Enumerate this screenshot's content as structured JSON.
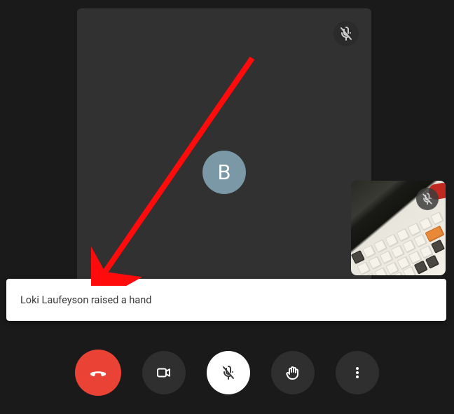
{
  "participant": {
    "avatar_initial": "B"
  },
  "notification": {
    "text": "Loki Laufeyson raised a hand"
  },
  "icons": {
    "participant_muted": "mic-muted-icon",
    "self_muted": "mic-muted-icon",
    "hangup": "phone-hangup-icon",
    "camera": "camera-icon",
    "mic_muted": "mic-muted-icon",
    "raise_hand": "hand-icon",
    "more": "more-icon"
  },
  "colors": {
    "hangup": "#ea4335",
    "dark_button": "#2f2f2f",
    "white_button": "#ffffff",
    "avatar": "#7a98a6",
    "video_bg": "#313131",
    "page_bg": "#1a1a1a",
    "arrow": "#ff0b0b"
  }
}
